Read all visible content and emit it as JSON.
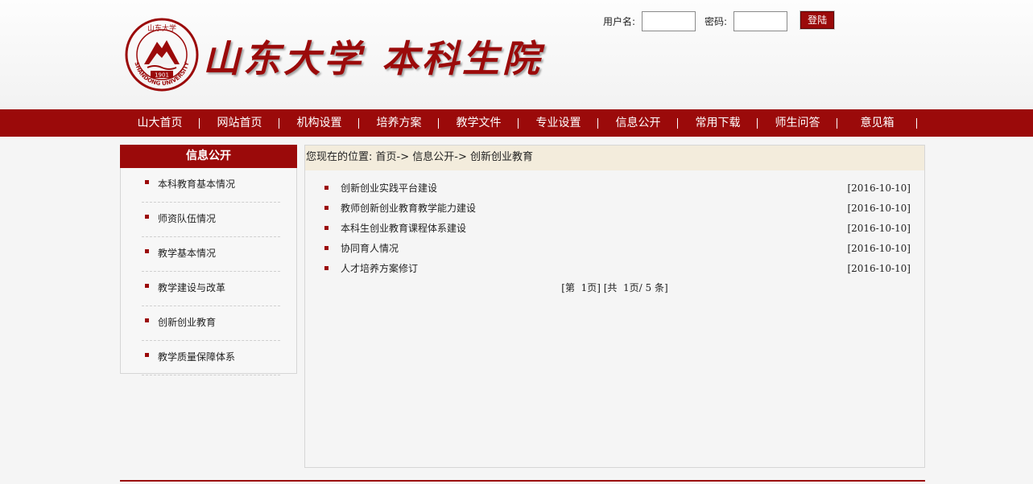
{
  "brand": {
    "seal_text": "SHANDONG UNIVERSITY",
    "seal_year": "1901",
    "name_part1": "山东大学",
    "name_part2": "本科生院",
    "color": "#9b0a0a"
  },
  "login": {
    "username_label": "用户名:",
    "username_value": "",
    "password_label": "密码:",
    "password_value": "",
    "submit_label": "登陆"
  },
  "nav": {
    "items": [
      "山大首页",
      "网站首页",
      "机构设置",
      "培养方案",
      "教学文件",
      "专业设置",
      "信息公开",
      "常用下载",
      "师生问答",
      "意见箱"
    ]
  },
  "sidebar": {
    "title": "信息公开",
    "items": [
      "本科教育基本情况",
      "师资队伍情况",
      "教学基本情况",
      "教学建设与改革",
      "创新创业教育",
      "教学质量保障体系"
    ]
  },
  "breadcrumb": {
    "prefix": "您现在的位置: ",
    "home": "首页",
    "sep1": "-> ",
    "section": "信息公开",
    "sep2": "-> ",
    "current": "创新创业教育"
  },
  "articles": [
    {
      "title": "创新创业实践平台建设",
      "date": "[2016-10-10]"
    },
    {
      "title": "教师创新创业教育教学能力建设",
      "date": "[2016-10-10]"
    },
    {
      "title": "本科生创业教育课程体系建设",
      "date": "[2016-10-10]"
    },
    {
      "title": "协同育人情况",
      "date": "[2016-10-10]"
    },
    {
      "title": "人才培养方案修订",
      "date": "[2016-10-10]"
    }
  ],
  "pager": {
    "text": "[第  1页] [共  1页/ 5 条]"
  }
}
